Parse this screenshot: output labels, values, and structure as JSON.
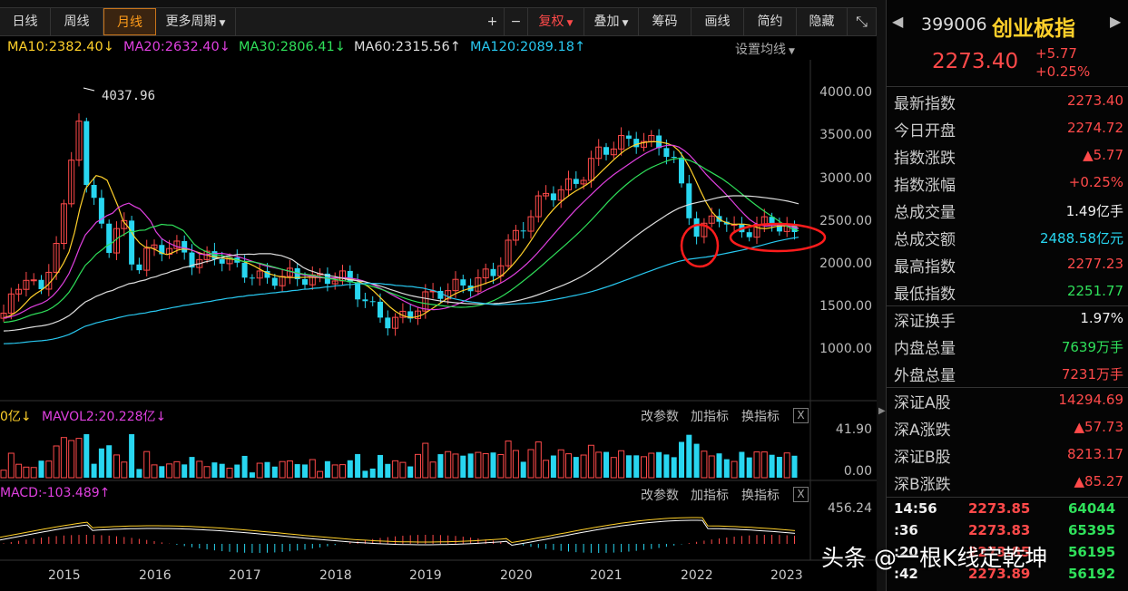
{
  "toolbar": {
    "items": [
      "日线",
      "周线",
      "月线",
      "更多周期",
      "+",
      "−",
      "复权",
      "叠加",
      "筹码",
      "画线",
      "简约",
      "隐藏"
    ],
    "active_index": 2
  },
  "ma_legend": [
    {
      "label": "MA10:2382.40",
      "arrow": "↓",
      "color": "#ffd02a"
    },
    {
      "label": "MA20:2632.40",
      "arrow": "↓",
      "color": "#e040e0"
    },
    {
      "label": "MA30:2806.41",
      "arrow": "↓",
      "color": "#2fe05a"
    },
    {
      "label": "MA60:2315.56",
      "arrow": "↑",
      "color": "#dddddd"
    },
    {
      "label": "MA120:2089.18",
      "arrow": "↑",
      "color": "#28c8f0"
    }
  ],
  "ma_settings": "设置均线",
  "chart": {
    "y_ticks": [
      "4000.00",
      "3500.00",
      "3000.00",
      "2500.00",
      "2000.00",
      "1500.00",
      "1000.00"
    ],
    "peak_label": "4037.96",
    "x_years": [
      "2015",
      "2016",
      "2017",
      "2018",
      "2019",
      "2020",
      "2021",
      "2022",
      "2023"
    ]
  },
  "volume_panel": {
    "legend_prefix": "0亿",
    "legend_prefix_arrow": "↓",
    "mavol2": "MAVOL2:20.228亿",
    "mavol2_arrow": "↓",
    "links": [
      "改参数",
      "加指标",
      "换指标"
    ],
    "close": "X",
    "ticks": [
      "41.90",
      "0.00"
    ]
  },
  "macd_panel": {
    "legend": "MACD:-103.489",
    "arrow": "↑",
    "links": [
      "改参数",
      "加指标",
      "换指标"
    ],
    "close": "X",
    "ticks": [
      "456.24"
    ]
  },
  "quote": {
    "code": "399006",
    "name": "创业板指",
    "price": "2273.40",
    "change": "+5.77",
    "change_pct": "+0.25%",
    "rows": [
      {
        "label": "最新指数",
        "value": "2273.40",
        "color": "red"
      },
      {
        "label": "今日开盘",
        "value": "2274.72",
        "color": "red"
      },
      {
        "label": "指数涨跌",
        "value": "▲5.77",
        "color": "red"
      },
      {
        "label": "指数涨幅",
        "value": "+0.25%",
        "color": "red"
      },
      {
        "label": "总成交量",
        "value": "1.49亿手",
        "color": "white"
      },
      {
        "label": "总成交额",
        "value": "2488.58亿元",
        "color": "cyan"
      },
      {
        "label": "最高指数",
        "value": "2277.23",
        "color": "red"
      },
      {
        "label": "最低指数",
        "value": "2251.77",
        "color": "green"
      },
      {
        "label": "深证换手",
        "value": "1.97%",
        "color": "white"
      },
      {
        "label": "内盘总量",
        "value": "7639万手",
        "color": "green"
      },
      {
        "label": "外盘总量",
        "value": "7231万手",
        "color": "red"
      },
      {
        "label": "深证A股",
        "value": "14294.69",
        "color": "red"
      },
      {
        "label": "深A涨跌",
        "value": "▲57.73",
        "color": "red"
      },
      {
        "label": "深证B股",
        "value": "8213.17",
        "color": "red"
      },
      {
        "label": "深B涨跌",
        "value": "▲85.27",
        "color": "red"
      }
    ],
    "ticks": [
      {
        "time": "14:56",
        "price": "2273.85",
        "vol": "64044"
      },
      {
        "time": ":36",
        "price": "2273.83",
        "vol": "65395"
      },
      {
        "time": ":20",
        "price": "2273.85",
        "vol": "56195"
      },
      {
        "time": ":42",
        "price": "2273.89",
        "vol": "56192"
      }
    ]
  },
  "watermark": "头条 @一根K线定乾坤",
  "colors": {
    "up": "#ff4a4a",
    "down": "#28d6f0",
    "accent": "#ff9c1a",
    "highlight": "#ff2020"
  }
}
